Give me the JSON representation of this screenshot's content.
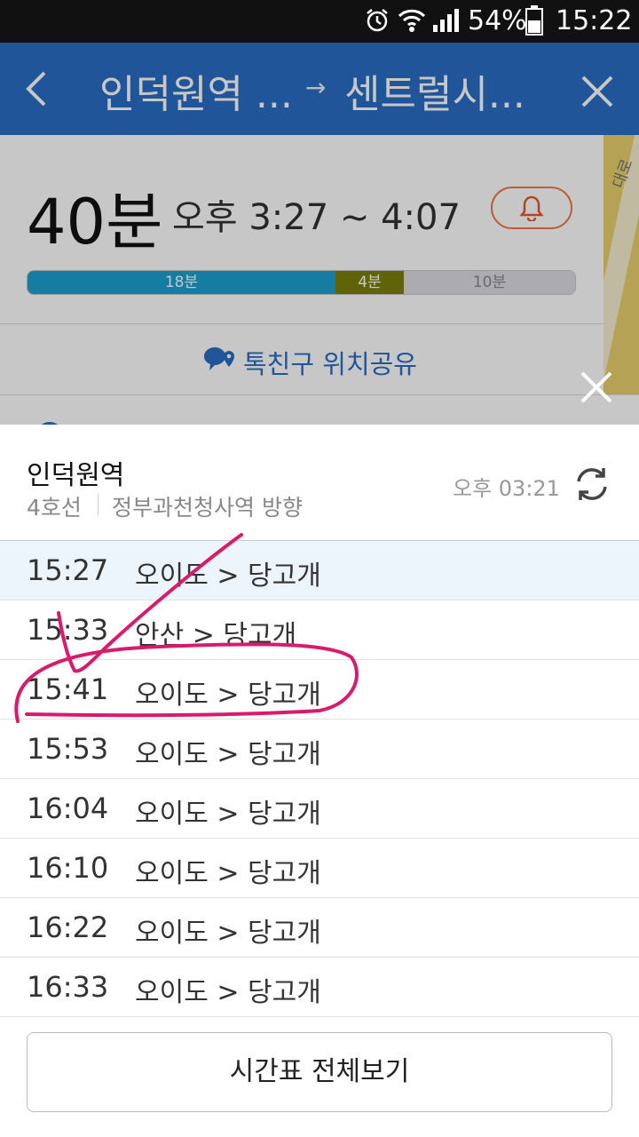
{
  "status_bar": {
    "battery": "54%",
    "clock": "15:22"
  },
  "header": {
    "origin": "인덕원역 ...",
    "destination": "센트럴시...",
    "arrow": "→"
  },
  "summary": {
    "duration": "40분",
    "time_range": "오후 3:27 ~ 4:07",
    "segments": [
      {
        "label": "18분",
        "minutes": 18,
        "color": "#1c9fd0"
      },
      {
        "label": "4분",
        "minutes": 4,
        "color": "#7c7f0a"
      },
      {
        "label": "10분",
        "minutes": 10,
        "color": "#dcdce2"
      }
    ],
    "share_label": "톡친구 위치공유",
    "map_label": "대로"
  },
  "sheet": {
    "station": "인덕원역",
    "line": "4호선",
    "direction": "정부과천청사역 방향",
    "updated": "오후 03:21",
    "departures": [
      {
        "time": "15:27",
        "route": "오이도 > 당고개"
      },
      {
        "time": "15:33",
        "route": "안산 > 당고개"
      },
      {
        "time": "15:41",
        "route": "오이도 > 당고개"
      },
      {
        "time": "15:53",
        "route": "오이도 > 당고개"
      },
      {
        "time": "16:04",
        "route": "오이도 > 당고개"
      },
      {
        "time": "16:10",
        "route": "오이도 > 당고개"
      },
      {
        "time": "16:22",
        "route": "오이도 > 당고개"
      },
      {
        "time": "16:33",
        "route": "오이도 > 당고개"
      }
    ],
    "full_timetable_label": "시간표 전체보기"
  },
  "colors": {
    "header_blue": "#2a6fc4",
    "alarm_orange": "#f07a4a",
    "annotation_pink": "#d81b6a"
  }
}
